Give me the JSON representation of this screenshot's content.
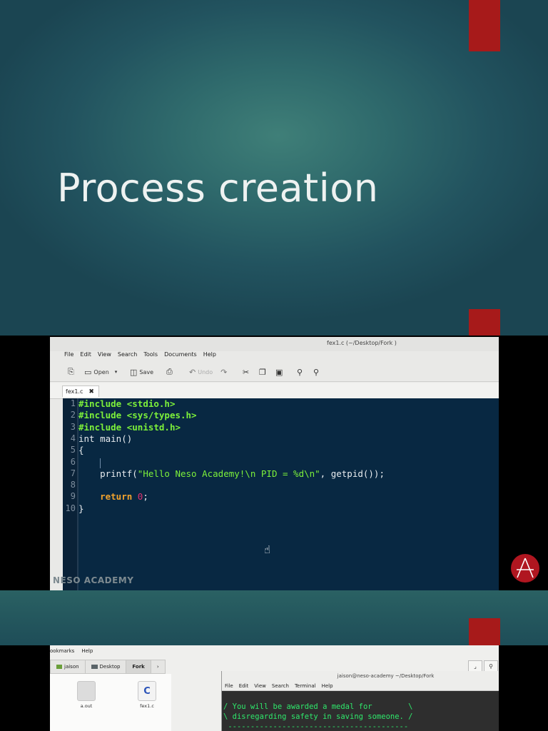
{
  "slide1": {
    "title": "Process creation"
  },
  "editor": {
    "window_title": "fex1.c (~/Desktop/Fork )",
    "menu": [
      "File",
      "Edit",
      "View",
      "Search",
      "Tools",
      "Documents",
      "Help"
    ],
    "toolbar": {
      "open": "Open",
      "save": "Save",
      "undo": "Undo"
    },
    "tab": {
      "label": "fex1.c"
    },
    "line_numbers": [
      "1",
      "2",
      "3",
      "4",
      "5",
      "6",
      "7",
      "8",
      "9",
      "10"
    ],
    "code": {
      "l1_kw": "#include",
      "l1_hdr": "<stdio.h>",
      "l2_kw": "#include",
      "l2_hdr": "<sys/types.h>",
      "l3_kw": "#include",
      "l3_hdr": "<unistd.h>",
      "l4": "int main()",
      "l5": "{",
      "l7_pre": "    printf(",
      "l7_str": "\"Hello Neso Academy!\\n PID = %d\\n\"",
      "l7_post": ", getpid());",
      "l9_pre": "    ",
      "l9_kw": "return",
      "l9_num": "0",
      "l9_post": ";",
      "l10": "}"
    },
    "watermark": "NESO ACADEMY"
  },
  "file_manager": {
    "menu": [
      "ookmarks",
      "Help"
    ],
    "crumbs": [
      "jaison",
      "Desktop",
      "Fork"
    ],
    "files": [
      {
        "name": "a.out"
      },
      {
        "name": "fex1.c"
      }
    ]
  },
  "terminal": {
    "title": "jaison@neso-academy ~/Desktop/Fork",
    "menu": [
      "File",
      "Edit",
      "View",
      "Search",
      "Terminal",
      "Help"
    ],
    "lines": [
      "/ You will be awarded a medal for        \\",
      "\\ disregarding safety in saving someone. /",
      " ----------------------------------------"
    ]
  },
  "colors": {
    "accent": "#a71a1a",
    "editor_bg": "#082842",
    "include_green": "#7cf03a",
    "keyword_orange": "#f2a32d"
  }
}
